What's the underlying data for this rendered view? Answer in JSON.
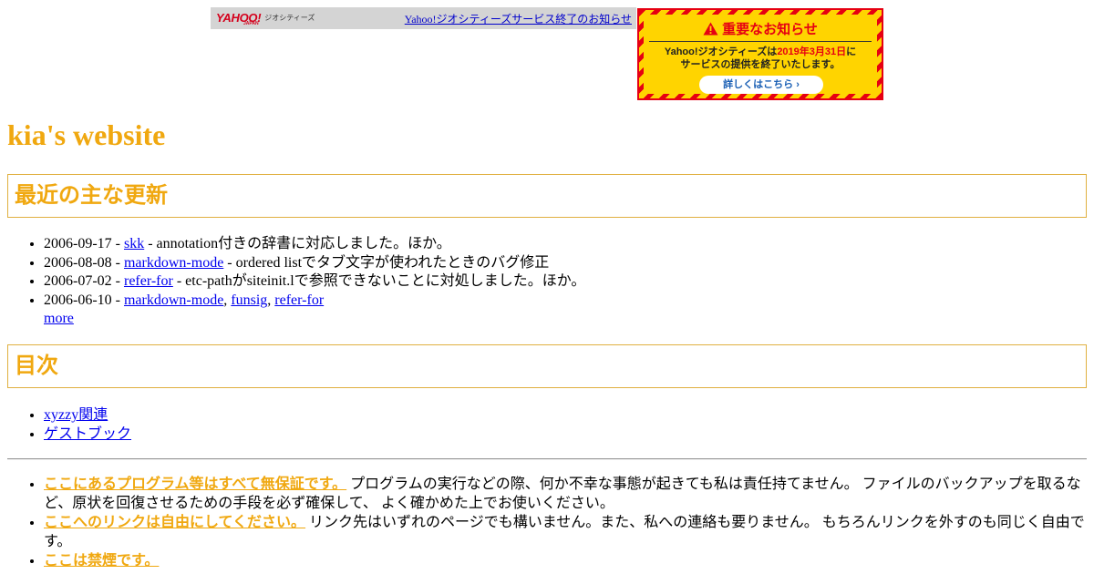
{
  "yahoo_bar": {
    "logo_text": "YAHOO!",
    "logo_sub": "JAPAN",
    "service_name": "ジオシティーズ",
    "link_text": "Yahoo!ジオシティーズサービス終了のお知らせ"
  },
  "notice": {
    "title": "重要なお知らせ",
    "line1_prefix": "Yahoo!ジオシティーズは",
    "line1_date": "2019年3月31日",
    "line1_suffix": "に",
    "line2": "サービスの提供を終了いたします。",
    "button_label": "詳しくはこちら ›",
    "colors": {
      "stripe_red": "#e60012",
      "stripe_yellow": "#ffd400",
      "link_blue": "#1a5fb4"
    }
  },
  "site_title": "kia's website",
  "updates_section": {
    "heading": "最近の主な更新",
    "items": [
      {
        "date": "2006-09-17 - ",
        "links": [
          "skk"
        ],
        "text": " - annotation付きの辞書に対応しました。ほか。"
      },
      {
        "date": "2006-08-08 - ",
        "links": [
          "markdown-mode"
        ],
        "text": " - ordered listでタブ文字が使われたときのバグ修正"
      },
      {
        "date": "2006-07-02 - ",
        "links": [
          "refer-for"
        ],
        "text": " - etc-pathがsiteinit.lで参照できないことに対処しました。ほか。"
      },
      {
        "date": "2006-06-10 - ",
        "links": [
          "markdown-mode",
          "funsig",
          "refer-for"
        ],
        "separator": ", "
      }
    ],
    "more_label": "more"
  },
  "toc_section": {
    "heading": "目次",
    "items": [
      "xyzzy関連",
      "ゲストブック"
    ]
  },
  "notes": [
    {
      "emphasis": "ここにあるプログラム等はすべて無保証です。",
      "text": " プログラムの実行などの際、何か不幸な事態が起きても私は責任持てません。 ファイルのバックアップを取るなど、原状を回復させるための手段を必ず確保して、 よく確かめた上でお使いください。"
    },
    {
      "emphasis": "ここへのリンクは自由にしてください。",
      "text": " リンク先はいずれのページでも構いません。また、私への連絡も要りません。 もちろんリンクを外すのも同じく自由です。"
    },
    {
      "emphasis": "ここは禁煙です。",
      "text": ""
    }
  ],
  "colors": {
    "accent": "#f0a810",
    "link": "#0000ee"
  }
}
